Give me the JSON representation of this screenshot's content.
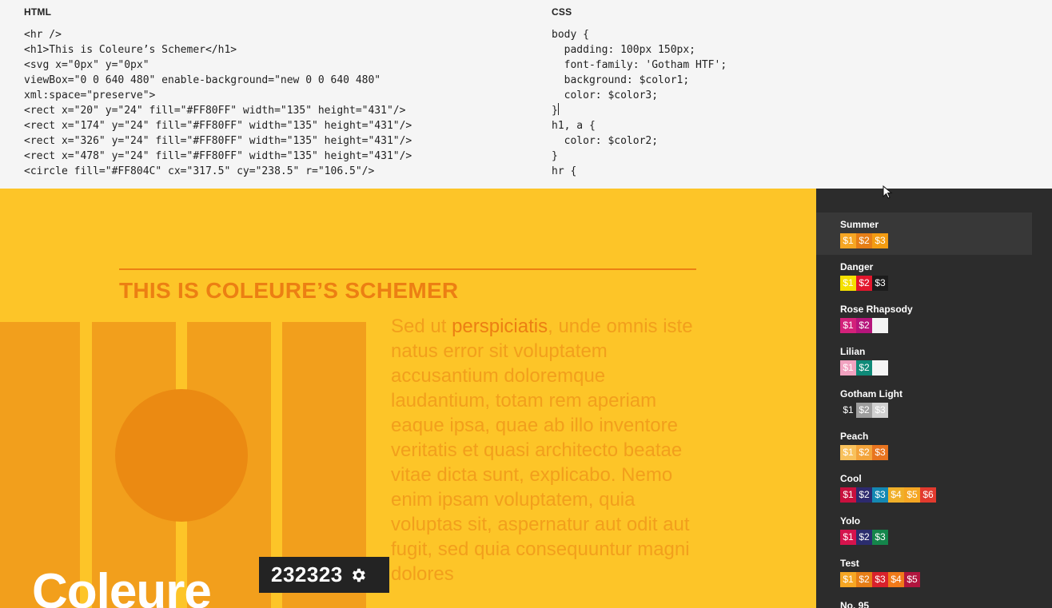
{
  "editor": {
    "html_title": "HTML",
    "css_title": "CSS",
    "html_lines": [
      "<hr />",
      "<h1>This is Coleure’s Schemer</h1>",
      "<svg x=\"0px\" y=\"0px\"",
      "viewBox=\"0 0 640 480\" enable-background=\"new 0 0 640 480\"",
      "xml:space=\"preserve\">",
      "<rect x=\"20\" y=\"24\" fill=\"#FF80FF\" width=\"135\" height=\"431\"/>",
      "<rect x=\"174\" y=\"24\" fill=\"#FF80FF\" width=\"135\" height=\"431\"/>",
      "<rect x=\"326\" y=\"24\" fill=\"#FF80FF\" width=\"135\" height=\"431\"/>",
      "<rect x=\"478\" y=\"24\" fill=\"#FF80FF\" width=\"135\" height=\"431\"/>",
      "<circle fill=\"#FF804C\" cx=\"317.5\" cy=\"238.5\" r=\"106.5\"/>"
    ],
    "css_lines": [
      "body {",
      "  padding: 100px 150px;",
      "  font-family: 'Gotham HTF';",
      "  background: $color1;",
      "  color: $color3;",
      "}",
      "h1, a {",
      "  color: $color2;",
      "}",
      "hr {"
    ]
  },
  "preview": {
    "headline": "THIS IS COLEURE’S SCHEMER",
    "body_before": "Sed ut ",
    "body_link": "perspiciatis",
    "body_after": ", unde omnis iste natus error sit voluptatem accusantium doloremque laudantium, totam rem aperiam eaque ipsa, quae ab illo inventore veritatis et quasi architecto beatae vitae dicta sunt, explicabo. Nemo enim ipsam voluptatem, quia voluptas sit, aspernatur aut odit aut fugit, sed quia consequuntur magni dolores",
    "big_word": "Coleure",
    "badge_hex": "232323",
    "badge_icon": "gear-icon",
    "colors": {
      "background": "#fdc528",
      "accent": "#ec7f13",
      "bars": "#f29f1c",
      "disc": "#eb8a12",
      "text": "#f29f1c"
    }
  },
  "sidebar": {
    "background": "#2c2c2c",
    "schemes": [
      {
        "name": "Summer",
        "active": true,
        "swatches": [
          {
            "label": "$1",
            "color": "#f6a623"
          },
          {
            "label": "$2",
            "color": "#e67e17"
          },
          {
            "label": "$3",
            "color": "#f39c12"
          }
        ]
      },
      {
        "name": "Danger",
        "active": false,
        "swatches": [
          {
            "label": "$1",
            "color": "#f5e000"
          },
          {
            "label": "$2",
            "color": "#e2162c"
          },
          {
            "label": "$3",
            "color": "#1c1c1c"
          }
        ]
      },
      {
        "name": "Rose Rhapsody",
        "active": false,
        "swatches": [
          {
            "label": "$1",
            "color": "#d3217a"
          },
          {
            "label": "$2",
            "color": "#b5157b"
          },
          {
            "label": "",
            "color": "#f3f3f3"
          }
        ]
      },
      {
        "name": "Lilian",
        "active": false,
        "swatches": [
          {
            "label": "$1",
            "color": "#f1a2c0"
          },
          {
            "label": "$2",
            "color": "#0f8a78"
          },
          {
            "label": "",
            "color": "#f5f5f5"
          }
        ]
      },
      {
        "name": "Gotham Light",
        "active": false,
        "swatches": [
          {
            "label": "$1",
            "color": "#2c2c2c"
          },
          {
            "label": "$2",
            "color": "#9e9e9e"
          },
          {
            "label": "$3",
            "color": "#d0d0d0"
          }
        ]
      },
      {
        "name": "Peach",
        "active": false,
        "swatches": [
          {
            "label": "$1",
            "color": "#f8c15c"
          },
          {
            "label": "$2",
            "color": "#f3a43b"
          },
          {
            "label": "$3",
            "color": "#e8741f"
          }
        ]
      },
      {
        "name": "Cool",
        "active": false,
        "swatches": [
          {
            "label": "$1",
            "color": "#c8103e"
          },
          {
            "label": "$2",
            "color": "#2d2a6e"
          },
          {
            "label": "$3",
            "color": "#1488b3"
          },
          {
            "label": "$4",
            "color": "#f0b02a"
          },
          {
            "label": "$5",
            "color": "#f5a623"
          },
          {
            "label": "$6",
            "color": "#e23a2e"
          }
        ]
      },
      {
        "name": "Yolo",
        "active": false,
        "swatches": [
          {
            "label": "$1",
            "color": "#d5134d"
          },
          {
            "label": "$2",
            "color": "#2b2d6e"
          },
          {
            "label": "$3",
            "color": "#14854b"
          }
        ]
      },
      {
        "name": "Test",
        "active": false,
        "swatches": [
          {
            "label": "$1",
            "color": "#f6a623"
          },
          {
            "label": "$2",
            "color": "#e67e17"
          },
          {
            "label": "$3",
            "color": "#d9212c"
          },
          {
            "label": "$4",
            "color": "#f07a1a"
          },
          {
            "label": "$5",
            "color": "#b0153e"
          }
        ]
      },
      {
        "name": "No. 95",
        "active": false,
        "swatches": []
      }
    ]
  }
}
